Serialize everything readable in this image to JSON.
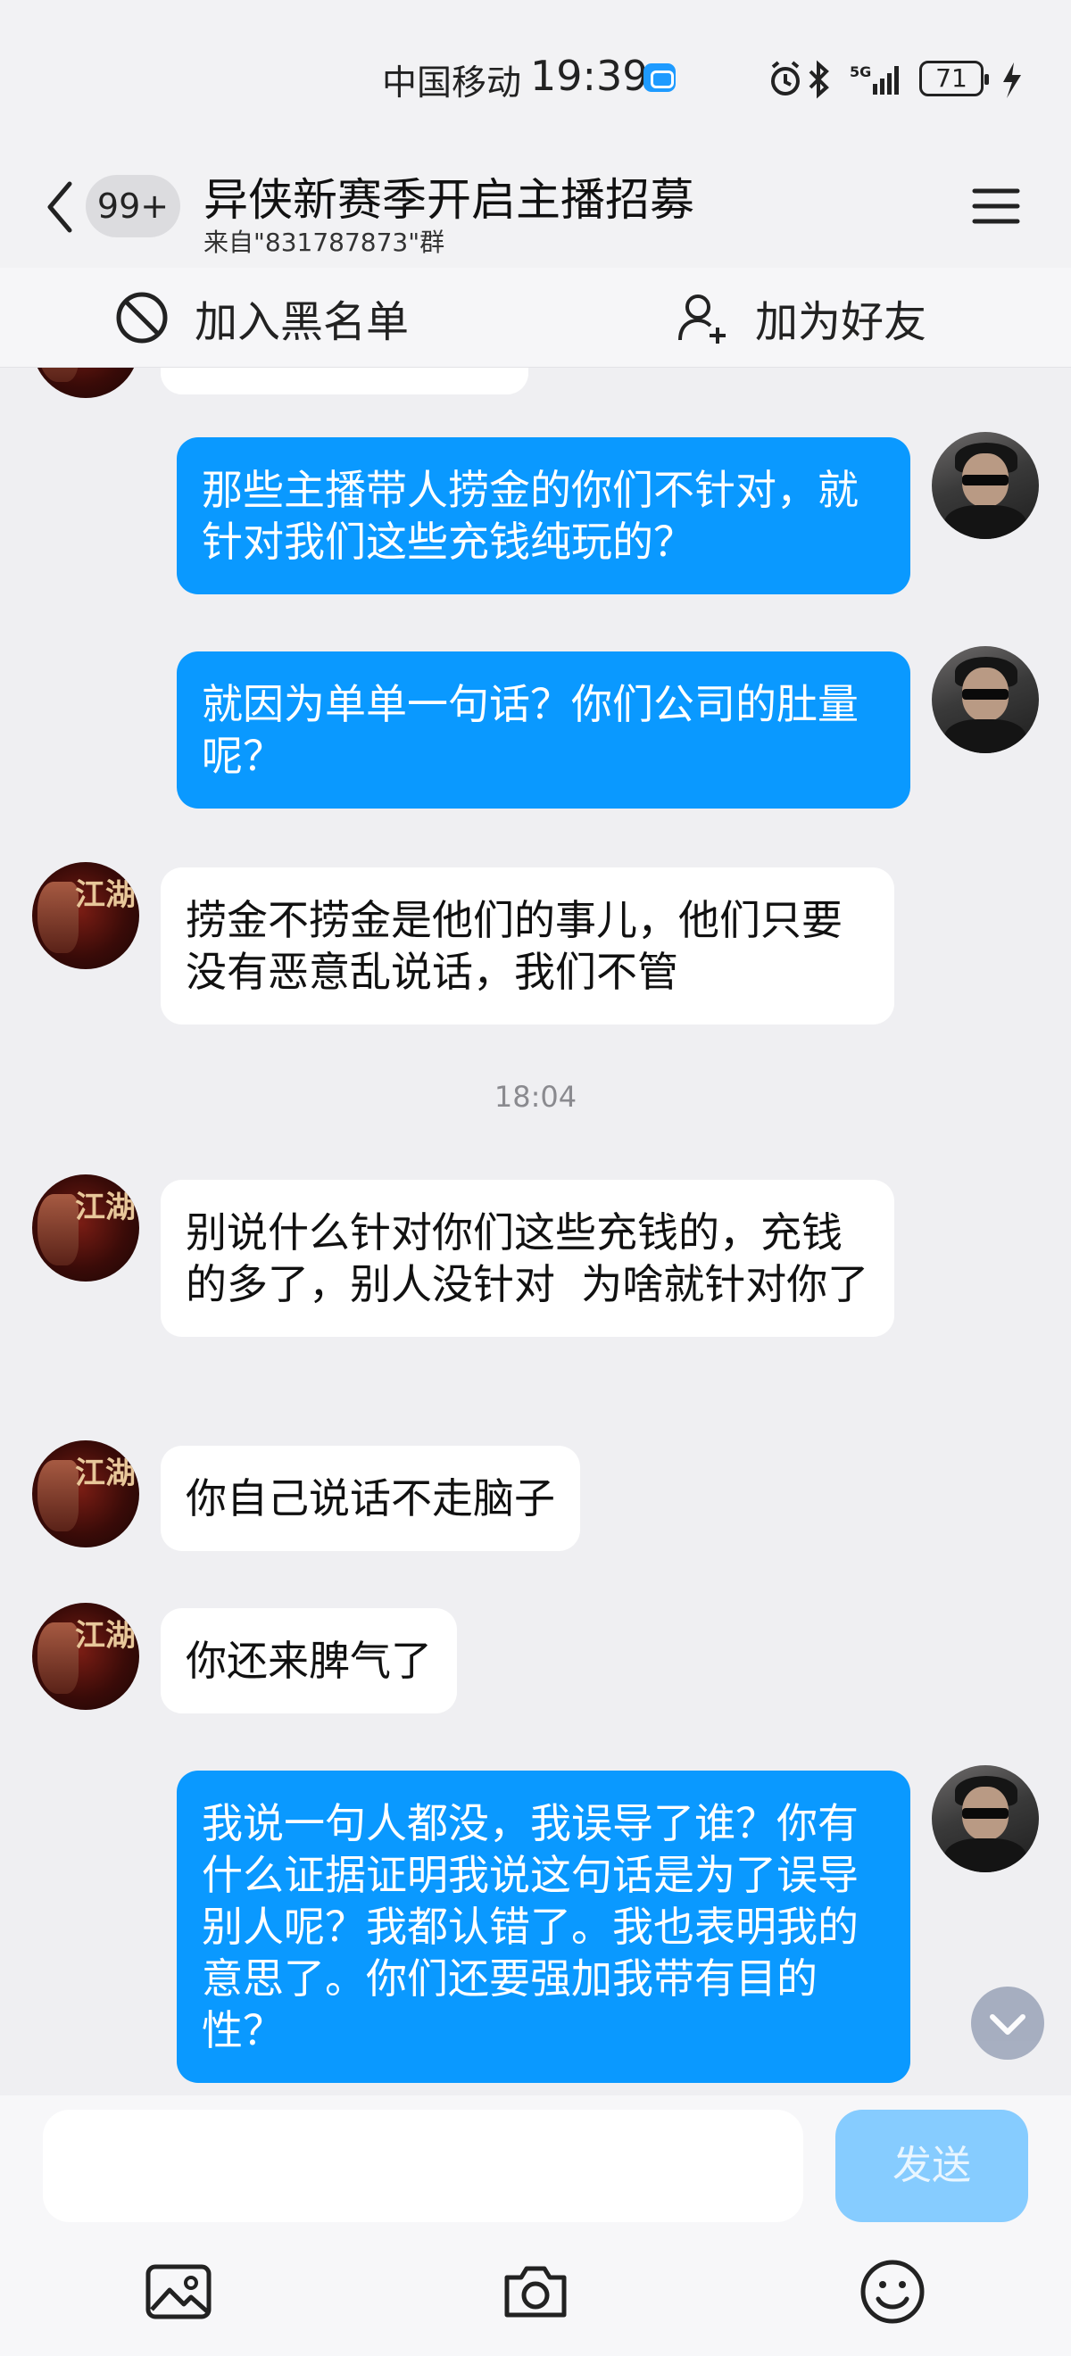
{
  "status_bar": {
    "carrier": "中国移动",
    "time": "19:39",
    "battery": "71",
    "network": "5G"
  },
  "header": {
    "unread_count": "99+",
    "title": "异侠新赛季开启主播招募",
    "subtitle": "来自\"831787873\"群"
  },
  "actions": {
    "block_label": "加入黑名单",
    "add_friend_label": "加为好友"
  },
  "messages": [
    {
      "sender": "me",
      "text": "那些主播带人捞金的你们不针对，就针对我们这些充钱纯玩的？"
    },
    {
      "sender": "me",
      "text": "就因为单单一句话？你们公司的肚量呢？"
    },
    {
      "sender": "other",
      "text": "捞金不捞金是他们的事儿，他们只要没有恶意乱说话，我们不管"
    },
    {
      "type": "time",
      "text": "18:04"
    },
    {
      "sender": "other",
      "text": "别说什么针对你们这些充钱的，充钱的多了，别人没针对  为啥就针对你了"
    },
    {
      "sender": "other",
      "text": "你自己说话不走脑子"
    },
    {
      "sender": "other",
      "text": "你还来脾气了"
    },
    {
      "sender": "me",
      "text": "我说一句人都没，我误导了谁？你有什么证据证明我说这句话是为了误导别人呢？我都认错了。我也表明我的意思了。你们还要强加我带有目的性？"
    }
  ],
  "avatar_other": {
    "glyph": "江湖"
  },
  "input": {
    "placeholder": "",
    "send_label": "发送"
  },
  "colors": {
    "outgoing_bubble": "#0a99ff",
    "incoming_bubble": "#ffffff",
    "send_button": "#86ccff"
  }
}
